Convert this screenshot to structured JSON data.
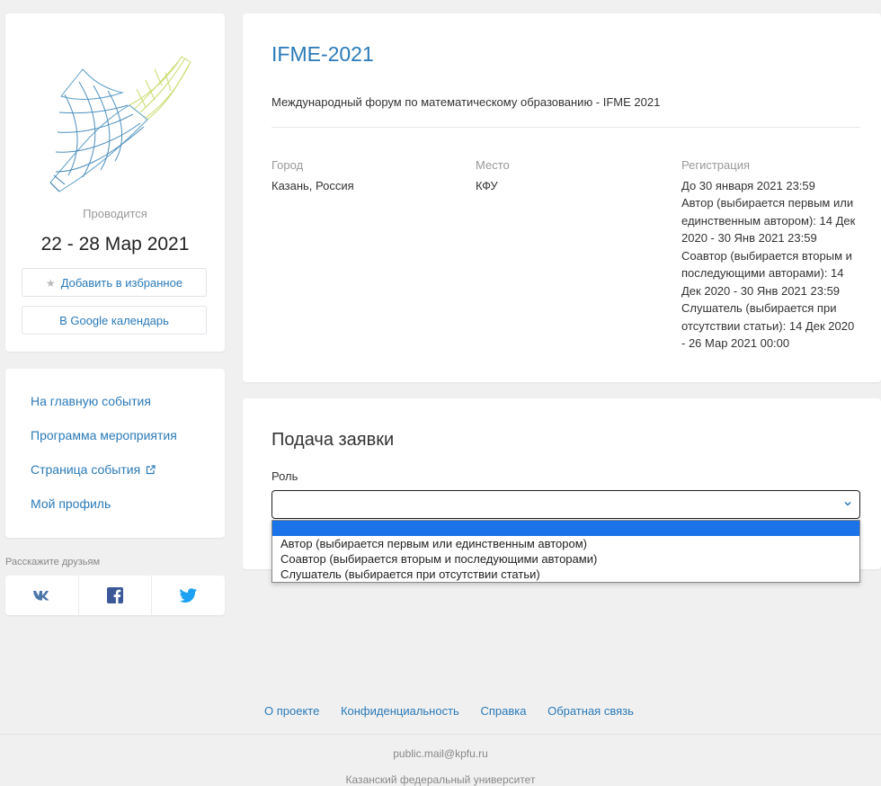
{
  "event": {
    "held_label": "Проводится",
    "dates": "22 - 28 Мар 2021",
    "favorite_label": "Добавить в избранное",
    "gcal_label": "В Google календарь"
  },
  "nav": {
    "items": [
      {
        "label": "На главную события"
      },
      {
        "label": "Программа мероприятия"
      },
      {
        "label": "Страница события"
      },
      {
        "label": "Мой профиль"
      }
    ]
  },
  "share": {
    "label": "Расскажите друзьям",
    "networks": [
      {
        "icon": "vk-icon",
        "color": "#4a76a8"
      },
      {
        "icon": "facebook-icon",
        "color": "#3b5998"
      },
      {
        "icon": "twitter-icon",
        "color": "#1da1f2"
      }
    ]
  },
  "info": {
    "title": "IFME-2021",
    "subtitle": "Международный форум по математическому образованию - IFME 2021",
    "city_label": "Город",
    "city_value": "Казань, Россия",
    "place_label": "Место",
    "place_value": "КФУ",
    "reg_label": "Регистрация",
    "reg_lines": [
      "До 30 января 2021 23:59",
      "Автор (выбирается первым или единственным автором): 14 Дек 2020 - 30 Янв 2021 23:59",
      "Соавтор (выбирается вторым и последующими авторами): 14 Дек 2020 - 30 Янв 2021 23:59",
      "Слушатель (выбирается при отсутствии статьи): 14 Дек 2020 - 26 Мар 2021 00:00"
    ]
  },
  "apply": {
    "title": "Подача заявки",
    "role_label": "Роль",
    "options": [
      "Автор (выбирается первым или единственным автором)",
      "Соавтор (выбирается вторым и последующими авторами)",
      "Слушатель (выбирается при отсутствии статьи)"
    ]
  },
  "footer": {
    "links": [
      "О проекте",
      "Конфиденциальность",
      "Справка",
      "Обратная связь"
    ],
    "email": "public.mail@kpfu.ru",
    "org": "Казанский федеральный университет"
  },
  "colors": {
    "accent": "#2a7ab8",
    "selected_option": "#1a73e8"
  }
}
